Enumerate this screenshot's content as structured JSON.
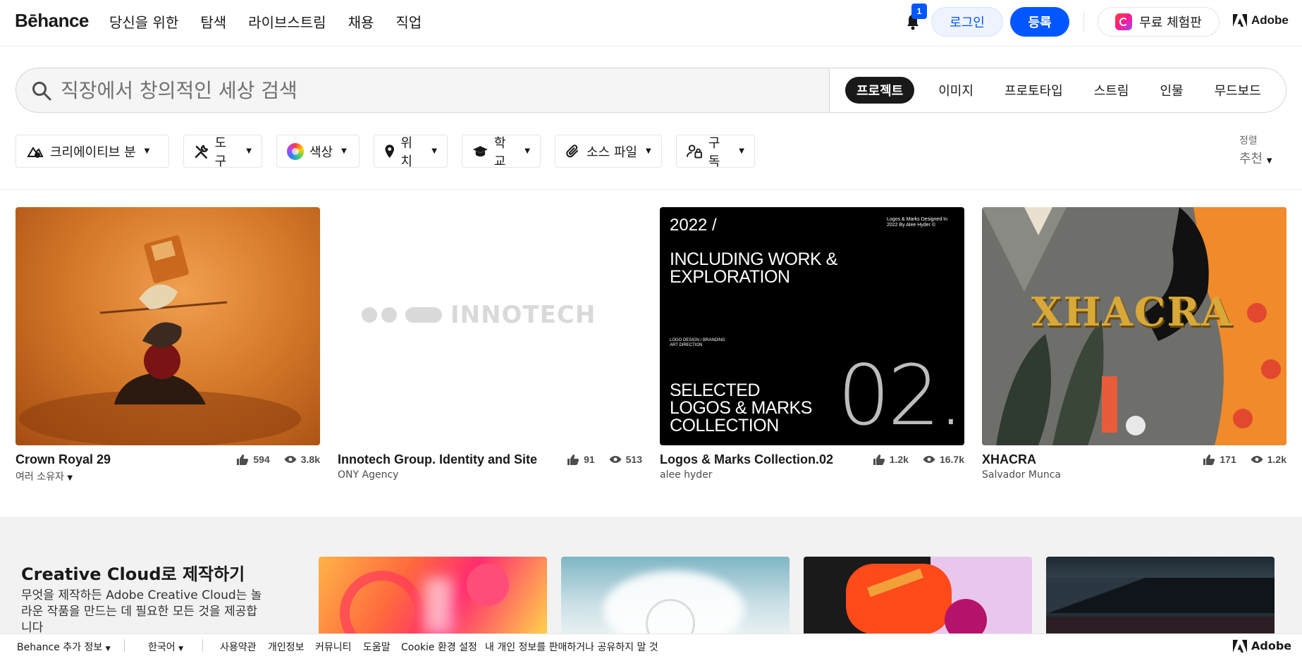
{
  "header": {
    "logo": "Bēhance",
    "nav": [
      "당신을 위한",
      "탐색",
      "라이브스트림",
      "채용",
      "직업"
    ],
    "notification_count": "1",
    "login_label": "로그인",
    "signup_label": "등록",
    "trial_label": "무료 체험판",
    "adobe_label": "Adobe"
  },
  "search": {
    "placeholder": "직장에서 창의적인 세상 검색",
    "tabs": [
      "프로젝트",
      "이미지",
      "프로토타입",
      "스트림",
      "인물",
      "무드보드"
    ],
    "active_tab": "프로젝트"
  },
  "filters": [
    {
      "label": "크리에이티브 분",
      "icon": "creative-fields-icon"
    },
    {
      "label": "도구",
      "icon": "tools-icon"
    },
    {
      "label": "색상",
      "icon": "color-wheel-icon"
    },
    {
      "label": "위치",
      "icon": "location-pin-icon"
    },
    {
      "label": "학교",
      "icon": "graduation-cap-icon"
    },
    {
      "label": "소스 파일",
      "icon": "paperclip-icon"
    },
    {
      "label": "구독",
      "icon": "subscription-lock-icon"
    }
  ],
  "sort": {
    "label": "정렬",
    "value": "추천"
  },
  "projects": [
    {
      "title": "Crown Royal 29",
      "owner": "여러 소유자",
      "likes": "594",
      "views": "3.8k"
    },
    {
      "title": "Innotech Group. Identity and Site",
      "owner": "ONY Agency",
      "likes": "91",
      "views": "513"
    },
    {
      "title": "Logos & Marks Collection.02",
      "owner": "alee hyder",
      "likes": "1.2k",
      "views": "16.7k"
    },
    {
      "title": "XHACRA",
      "owner": "Salvador Munca",
      "likes": "171",
      "views": "1.2k"
    }
  ],
  "thumb_text": {
    "innotech": "INNOTECH",
    "logos_year": "2022 /",
    "logos_small": "Logos & Marks Designed In 2022 By Alee Hyder ©",
    "logos_headline": "INCLUDING WORK & EXPLORATION",
    "logos_tag1": "LOGO DESIGN / BRANDING",
    "logos_tag2": "ART DIRECTION",
    "logos_selected": "SELECTED LOGOS & MARKS COLLECTION",
    "logos_number": "02.",
    "xhacra": "XHACRA"
  },
  "creative_cloud": {
    "title": "Creative Cloud로 제작하기",
    "description": "무엇을 제작하든 Adobe Creative Cloud는 놀라운 작품을 만드는 데 필요한 모든 것을 제공합니다"
  },
  "footer": {
    "more_info": "Behance 추가 정보",
    "language": "한국어",
    "links": [
      "사용약관",
      "개인정보",
      "커뮤니티",
      "도움말",
      "Cookie 환경 설정",
      "내 개인 정보를 판매하거나 공유하지 말 것"
    ],
    "adobe_label": "Adobe"
  },
  "colors": {
    "accent": "#0057ff",
    "text": "#191919",
    "band": "#f2f2f2"
  }
}
